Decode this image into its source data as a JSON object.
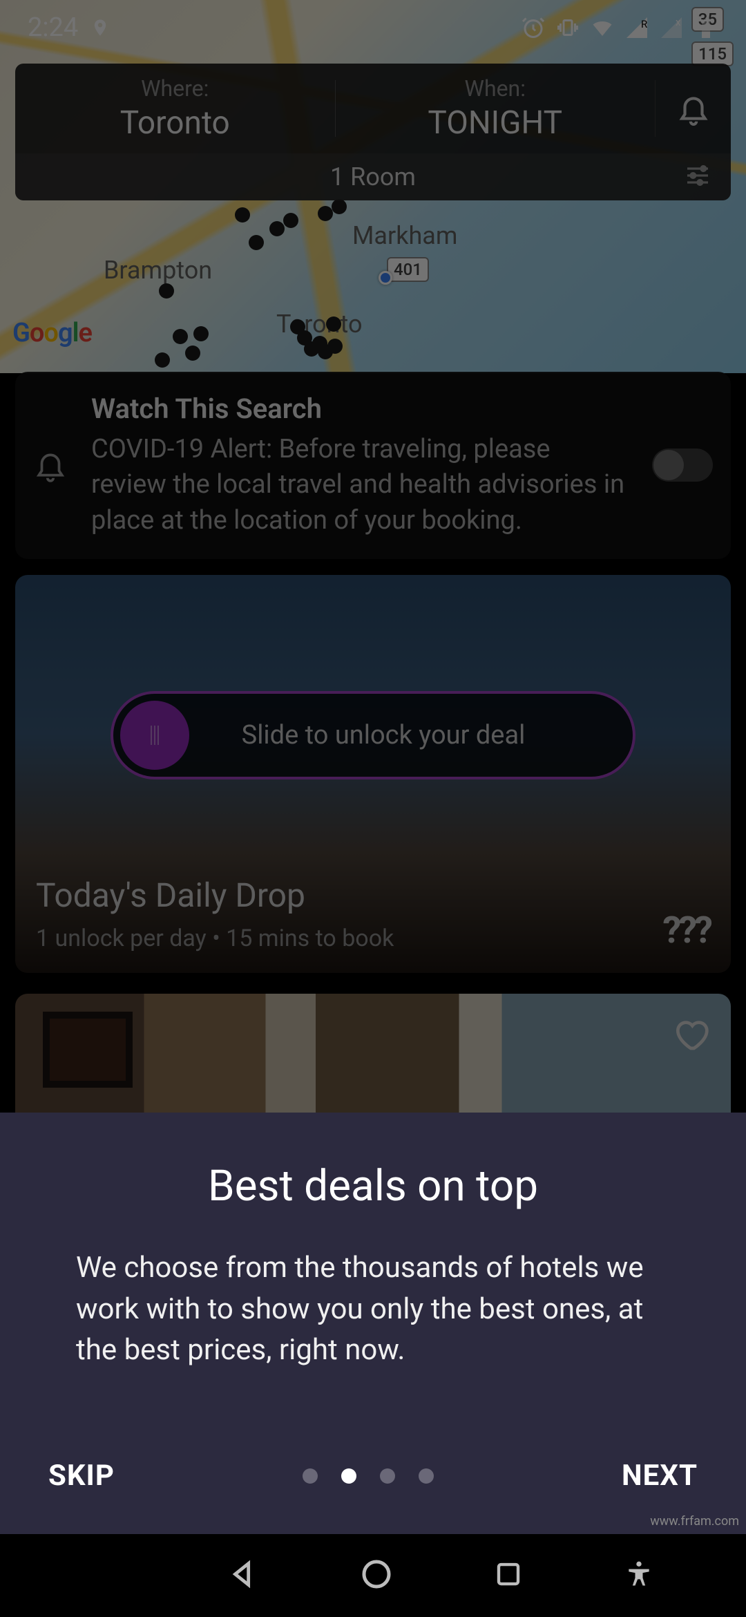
{
  "status": {
    "time": "2:24"
  },
  "search": {
    "where_label": "Where:",
    "where_value": "Toronto",
    "when_label": "When:",
    "when_value": "TONIGHT",
    "rooms": "1 Room"
  },
  "map": {
    "cities": [
      "Brampton",
      "Markham",
      "Toronto"
    ],
    "routes": [
      "35",
      "115",
      "401"
    ],
    "attribution": "Google"
  },
  "watch": {
    "title": "Watch This Search",
    "body": "COVID-19 Alert: Before traveling, please review the local travel and health advisories in place at the location of your booking.",
    "enabled": false
  },
  "daily_drop": {
    "slide_text": "Slide to unlock your deal",
    "title": "Today's Daily Drop",
    "subtitle": "1 unlock per day  •  15 mins to book",
    "mystery": "???"
  },
  "onboarding": {
    "title": "Best deals on top",
    "body": "We choose from the thousands of hotels we work with to show you only the best ones, at the best prices, right now.",
    "skip": "SKIP",
    "next": "NEXT",
    "page_index": 1,
    "page_count": 4
  },
  "watermark": "www.frfam.com"
}
